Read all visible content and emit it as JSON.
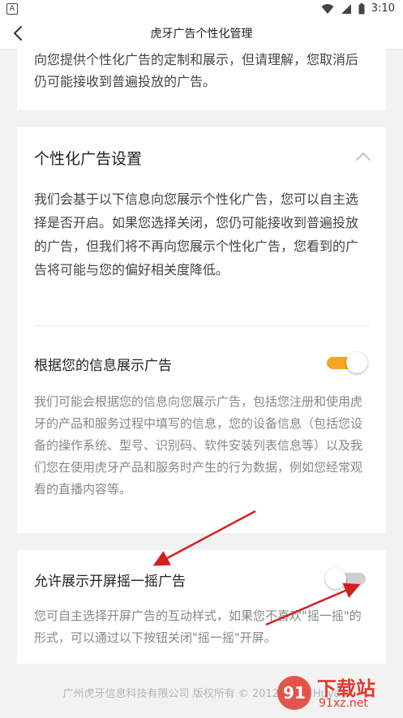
{
  "status_bar": {
    "left_badge": "A",
    "time": "3:10"
  },
  "nav": {
    "title": "虎牙广告个性化管理"
  },
  "intro": {
    "text": "向您提供个性化广告的定制和展示，但请理解，您取消后仍可能接收到普遍投放的广告。"
  },
  "ad_settings": {
    "title": "个性化广告设置",
    "description": "我们会基于以下信息向您展示个性化广告，您可以自主选择是否开启。如果您选择关闭，您仍可能接收到普遍投放的广告，但我们将不再向您展示个性化广告，您看到的广告将可能与您的偏好相关度降低。",
    "info_ads": {
      "label": "根据您的信息展示广告",
      "enabled": true,
      "description": "我们可能会根据您的信息向您展示广告，包括您注册和使用虎牙的产品和服务过程中填写的信息，您的设备信息（包括您设备的操作系统、型号、识别码、软件安装列表信息等）以及我们您在使用虎牙产品和服务时产生的行为数据，例如您经常观看的直播内容等。"
    }
  },
  "shake_ads": {
    "label": "允许展示开屏摇一摇广告",
    "enabled": false,
    "description": "您可自主选择开屏广告的互动样式，如果您不喜欢\"摇一摇\"的形式，可以通过以下按钮关闭\"摇一摇\"开屏。"
  },
  "footer": {
    "text": "广州虎牙信息科技有限公司 版权所有 © 2012-2019 Huya"
  },
  "watermark": {
    "text": "下载站",
    "sub": "91xz.net"
  },
  "colors": {
    "toggle_on": "#f5a623",
    "toggle_off": "#cfcfcf",
    "annotation_arrow": "#d42020"
  }
}
